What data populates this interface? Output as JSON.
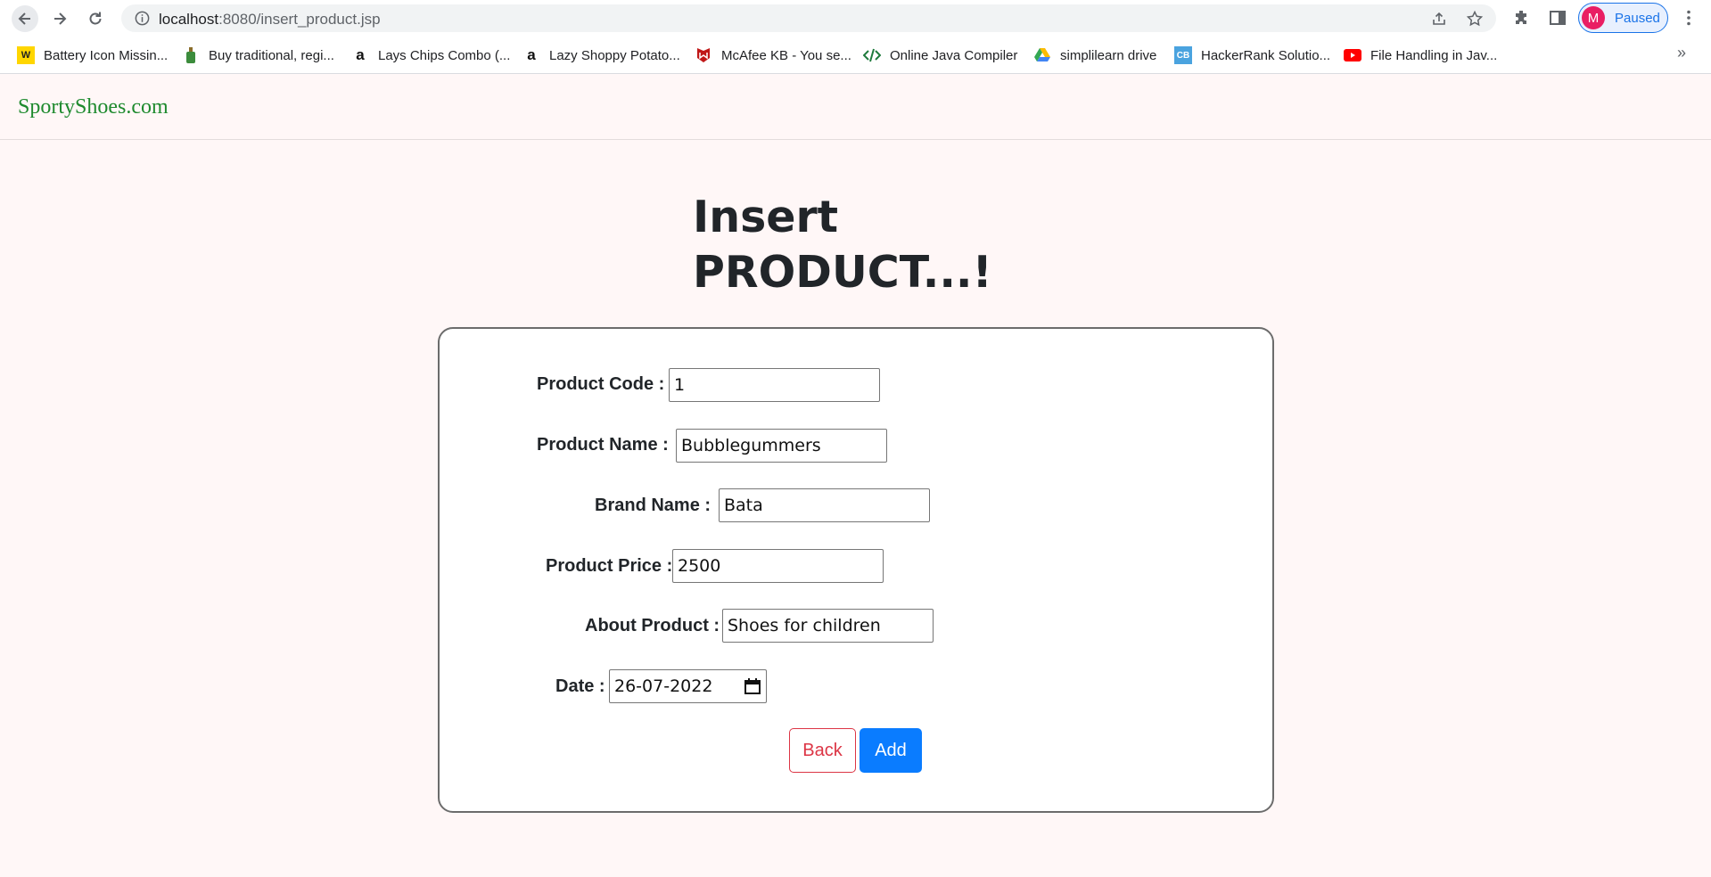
{
  "browser": {
    "url_host": "localhost",
    "url_path": ":8080/insert_product.jsp",
    "profile_initial": "M",
    "profile_status": "Paused",
    "bookmarks": [
      {
        "label": "Battery Icon Missin...",
        "icon": "w-logo-icon"
      },
      {
        "label": "Buy traditional, regi...",
        "icon": "bottle-icon"
      },
      {
        "label": "Lays Chips Combo (...",
        "icon": "amazon-icon"
      },
      {
        "label": "Lazy Shoppy Potato...",
        "icon": "amazon-icon"
      },
      {
        "label": "McAfee KB - You se...",
        "icon": "mcafee-icon"
      },
      {
        "label": "Online Java Compiler",
        "icon": "code-icon"
      },
      {
        "label": "simplilearn drive",
        "icon": "google-drive-icon"
      },
      {
        "label": "HackerRank Solutio...",
        "icon": "cb-icon"
      },
      {
        "label": "File Handling in Jav...",
        "icon": "youtube-icon"
      }
    ],
    "more_glyph": "»"
  },
  "site": {
    "brand": "SportyShoes.com"
  },
  "page": {
    "heading_line1": "Insert",
    "heading_line2": "PRODUCT...!"
  },
  "form": {
    "product_code_label": "Product Code :",
    "product_code_value": "1",
    "product_name_label": "Product Name :",
    "product_name_value": "Bubblegummers",
    "brand_name_label": "Brand Name :",
    "brand_name_value": "Bata",
    "product_price_label": "Product Price :",
    "product_price_value": "2500",
    "about_product_label": "About Product :",
    "about_product_value": "Shoes for children",
    "date_label": "Date :",
    "date_value": "26-07-2022",
    "back_label": "Back",
    "add_label": "Add"
  },
  "colors": {
    "brand": "#1e8a2e",
    "page_bg": "#fff7f7",
    "add_button": "#0a7cff",
    "back_button": "#dc3545"
  }
}
